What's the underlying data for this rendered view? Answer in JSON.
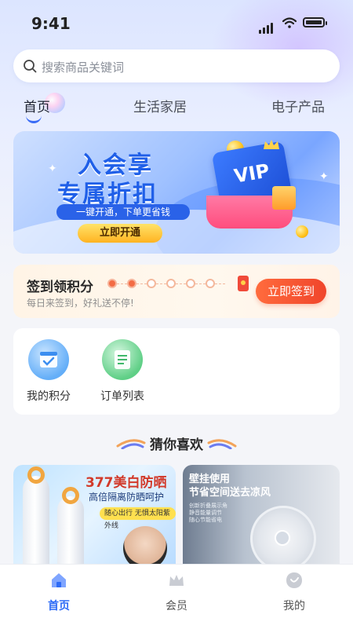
{
  "status_bar": {
    "time": "9:41"
  },
  "search": {
    "placeholder": "搜索商品关键词"
  },
  "tabs": [
    {
      "label": "首页",
      "active": true
    },
    {
      "label": "生活家居",
      "active": false
    },
    {
      "label": "电子产品",
      "active": false
    }
  ],
  "banner": {
    "title_line1": "入会享",
    "title_line2": "专属折扣",
    "tagline": "一键开通，下单更省钱",
    "cta": "立即开通",
    "card_text": "VIP"
  },
  "signin": {
    "title": "签到领积分",
    "subtitle": "每日来签到，好礼送不停!",
    "button": "立即签到",
    "days_total": 7,
    "days_checked": 2
  },
  "quick_actions": [
    {
      "label": "我的积分",
      "icon": "calendar-check-icon"
    },
    {
      "label": "订单列表",
      "icon": "order-list-icon"
    }
  ],
  "section": {
    "title": "猜你喜欢"
  },
  "products": [
    {
      "headline": "377美白防晒",
      "subline": "高倍隔离防晒呵护",
      "tag": "随心出行 无惧太阳紫外线"
    },
    {
      "headline": "壁挂使用\n节省空间送去凉风",
      "detail": "创新折叠展示角\n静音能量调节\n随心节能省电"
    }
  ],
  "bottom_nav": [
    {
      "label": "首页",
      "icon": "home-icon",
      "active": true
    },
    {
      "label": "会员",
      "icon": "crown-icon",
      "active": false
    },
    {
      "label": "我的",
      "icon": "profile-icon",
      "active": false
    }
  ],
  "colors": {
    "accent": "#2f6cf6",
    "signin_button": "#f0452b",
    "banner_title": "#1f5fe8"
  }
}
